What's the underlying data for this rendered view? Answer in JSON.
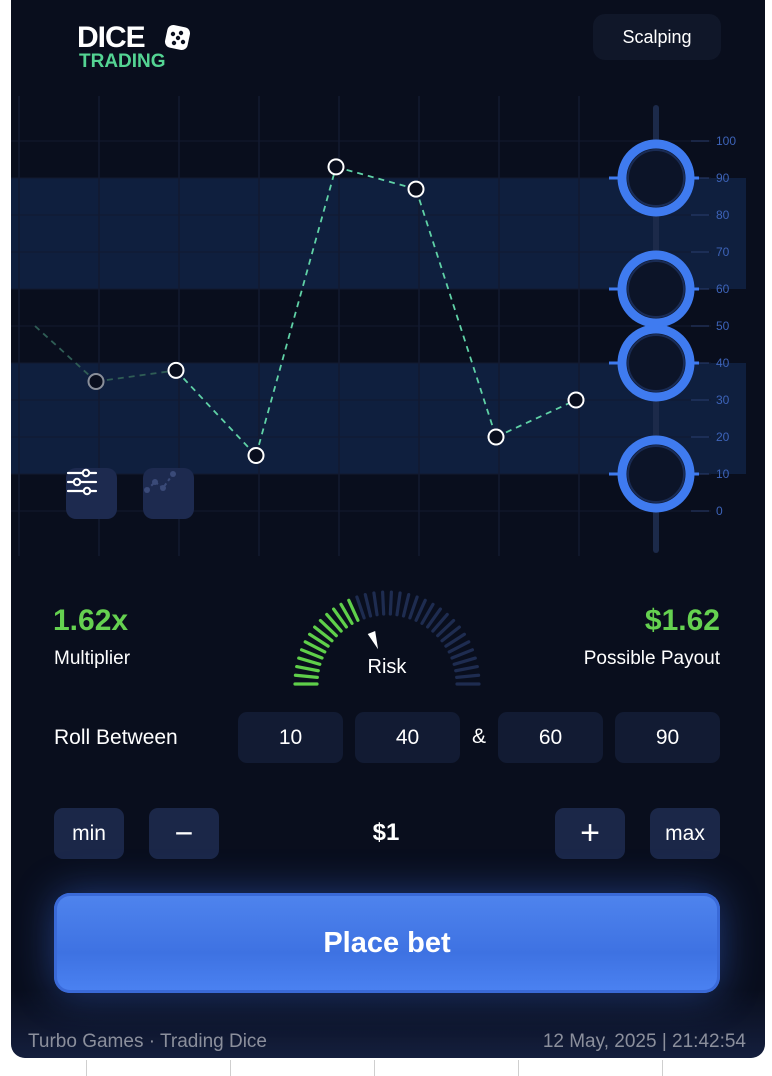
{
  "header": {
    "logo_line1": "DICE",
    "logo_line2": "TRADING",
    "mode_button": "Scalping"
  },
  "chart_data": {
    "type": "line",
    "y_ticks": [
      "100",
      "90",
      "80",
      "70",
      "60",
      "50",
      "40",
      "30",
      "20",
      "10",
      "0"
    ],
    "ylim": [
      0,
      100
    ],
    "points": [
      {
        "y": 50,
        "faded": true
      },
      {
        "y": 35,
        "faded": true
      },
      {
        "y": 38
      },
      {
        "y": 15
      },
      {
        "y": 93
      },
      {
        "y": 87
      },
      {
        "y": 20
      },
      {
        "y": 30
      }
    ],
    "ranges": [
      [
        10,
        40
      ],
      [
        60,
        90
      ]
    ],
    "handles": [
      90,
      60,
      40,
      10
    ],
    "colors": {
      "line": "#5fd1a6",
      "band": "#0f1f3e",
      "handle": "#3f7bf0",
      "tick": "#3d63b8"
    }
  },
  "tools": {
    "settings_icon": "sliders-icon",
    "chart_icon": "scatter-chart-icon"
  },
  "stats": {
    "multiplier_value": "1.62x",
    "multiplier_label": "Multiplier",
    "risk_label": "Risk",
    "risk_level": 0.38,
    "payout_value": "$1.62",
    "payout_label": "Possible Payout"
  },
  "roll": {
    "label": "Roll Between",
    "low_from": "10",
    "low_to": "40",
    "separator": "&",
    "high_from": "60",
    "high_to": "90"
  },
  "bet": {
    "min_label": "min",
    "minus_label": "−",
    "amount": "$1",
    "plus_label": "+",
    "max_label": "max",
    "place_label": "Place bet"
  },
  "footer": {
    "left": "Turbo Games · Trading Dice",
    "right": "12 May, 2025 | 21:42:54"
  }
}
